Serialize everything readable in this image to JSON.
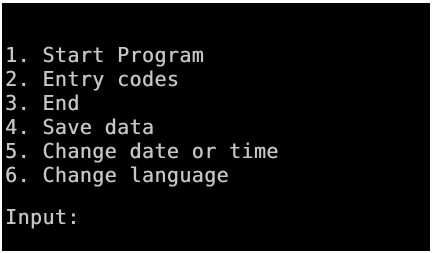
{
  "console": {
    "menu_items": [
      {
        "number": "1.",
        "label": "Start Program"
      },
      {
        "number": "2.",
        "label": "Entry codes"
      },
      {
        "number": "3.",
        "label": "End"
      },
      {
        "number": "4.",
        "label": "Save data"
      },
      {
        "number": "5.",
        "label": "Change date or time"
      },
      {
        "number": "6.",
        "label": "Change language"
      }
    ],
    "prompt": "Input:",
    "input_value": "",
    "colors": {
      "background": "#000000",
      "text": "#c6c6c6",
      "frame": "#ffffff"
    }
  }
}
